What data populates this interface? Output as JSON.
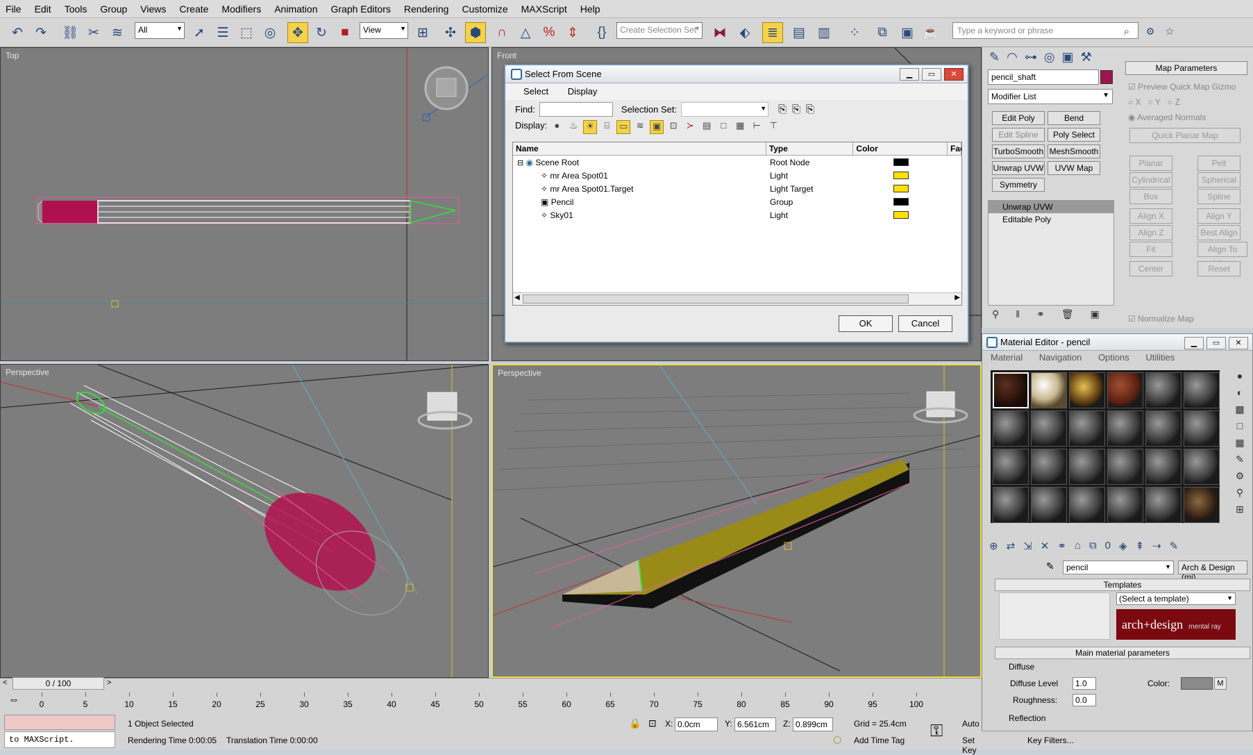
{
  "menubar": [
    "File",
    "Edit",
    "Tools",
    "Group",
    "Views",
    "Create",
    "Modifiers",
    "Animation",
    "Graph Editors",
    "Rendering",
    "Customize",
    "MAXScript",
    "Help"
  ],
  "toolbar": {
    "filter_value": "All",
    "refcoord_value": "View",
    "selset_placeholder": "Create Selection Set",
    "search_placeholder": "Type a keyword or phrase"
  },
  "viewports": {
    "top_left": "Top",
    "top_right": "Front",
    "bottom_left": "Perspective",
    "bottom_right": "Perspective"
  },
  "select_dialog": {
    "title": "Select From Scene",
    "menu": [
      "Select",
      "Display"
    ],
    "find_label": "Find:",
    "selset_label": "Selection Set:",
    "display_label": "Display:",
    "columns": [
      "Name",
      "Type",
      "Color",
      "Fac"
    ],
    "rows": [
      {
        "name": "Scene Root",
        "type": "Root Node",
        "color": "#000000"
      },
      {
        "name": "mr Area Spot01",
        "type": "Light",
        "color": "#ffe000"
      },
      {
        "name": "mr Area Spot01.Target",
        "type": "Light Target",
        "color": "#ffe000"
      },
      {
        "name": "Pencil",
        "type": "Group",
        "color": "#000000"
      },
      {
        "name": "Sky01",
        "type": "Light",
        "color": "#ffe000"
      }
    ],
    "ok_label": "OK",
    "cancel_label": "Cancel"
  },
  "command_panel": {
    "object_name": "pencil_shaft",
    "object_color": "#a0144e",
    "modifier_list": "Modifier List",
    "modifier_buttons": [
      "Edit Poly",
      "Bend",
      "Edit Spline",
      "Poly Select",
      "TurboSmooth",
      "MeshSmooth",
      "Unwrap UVW",
      "UVW Map",
      "Symmetry"
    ],
    "stack": [
      "Unwrap UVW",
      "Editable Poly"
    ],
    "map_params": {
      "title": "Map Parameters",
      "preview": "Preview Quick Map Gizmo",
      "x": "X",
      "y": "Y",
      "z": "Z",
      "averaged": "Averaged Normals",
      "quick_planar": "Quick Planar Map",
      "buttons": [
        "Planar",
        "Pelt",
        "Cylindrical",
        "Spherical",
        "Box",
        "Spline",
        "Align X",
        "Align Y",
        "Align Z",
        "Best Align",
        "Fit",
        "Align To View",
        "Center",
        "Reset"
      ],
      "normalize": "Normalize Map"
    }
  },
  "material_editor": {
    "title": "Material Editor - pencil",
    "menu": [
      "Material",
      "Navigation",
      "Options",
      "Utilities"
    ],
    "material_name": "pencil",
    "material_type": "Arch & Design (mi)",
    "templates_header": "Templates",
    "template_select": "(Select a template)",
    "logo_text": "arch+design",
    "logo_sub": "mental ray",
    "main_params_header": "Main material parameters",
    "diffuse_label": "Diffuse",
    "diffuse_level_label": "Diffuse Level",
    "diffuse_level_value": "1.0",
    "color_label": "Color:",
    "roughness_label": "Roughness:",
    "roughness_value": "0.0",
    "reflection_label": "Reflection",
    "m_label": "M"
  },
  "status": {
    "frame_slider": "0 / 100",
    "timeline_ticks": [
      "0",
      "5",
      "10",
      "15",
      "20",
      "25",
      "30",
      "35",
      "40",
      "45",
      "50",
      "55",
      "60",
      "65",
      "70",
      "75",
      "80",
      "85",
      "90",
      "95",
      "100"
    ],
    "selected": "1 Object Selected",
    "rendering_time": "Rendering Time  0:00:05",
    "translation_time": "Translation Time  0:00:00",
    "maxscript": "to MAXScript.",
    "x_label": "X:",
    "x_value": "0.0cm",
    "y_label": "Y:",
    "y_value": "6.561cm",
    "z_label": "Z:",
    "z_value": "0.899cm",
    "grid": "Grid = 25.4cm",
    "add_time_tag": "Add Time Tag",
    "auto_key": "Auto",
    "set_key": "Set Key",
    "key_filters": "Key Filters..."
  }
}
